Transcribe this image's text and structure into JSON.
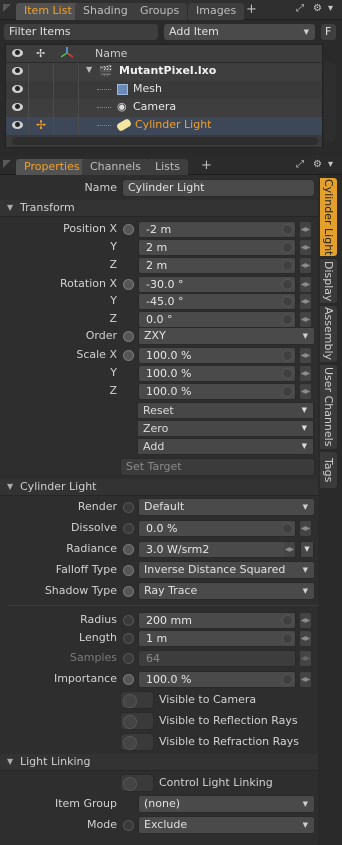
{
  "top_tabs": [
    "Item List",
    "Shading",
    "Groups",
    "Images"
  ],
  "filter_label": "Filter Items",
  "add_item_label": "Add Item",
  "f_button": "F",
  "list_header_name": "Name",
  "items": [
    {
      "label": "MutantPixel.lxo",
      "type": "scene"
    },
    {
      "label": "Mesh",
      "type": "mesh"
    },
    {
      "label": "Camera",
      "type": "camera"
    },
    {
      "label": "Cylinder Light",
      "type": "light",
      "selected": true
    }
  ],
  "props_tabs": [
    "Properties",
    "Channels",
    "Lists"
  ],
  "vertical_tabs": [
    "Cylinder Light",
    "Display",
    "Assembly",
    "User Channels",
    "Tags"
  ],
  "name_label": "Name",
  "name_value": "Cylinder Light",
  "transform": {
    "header": "Transform",
    "position_label": "Position X",
    "pos": [
      "-2 m",
      "2 m",
      "2 m"
    ],
    "rotation_label": "Rotation X",
    "rot": [
      "-30.0 °",
      "-45.0 °",
      "0.0 °"
    ],
    "order_label": "Order",
    "order_value": "ZXY",
    "scale_label": "Scale X",
    "scale": [
      "100.0 %",
      "100.0 %",
      "100.0 %"
    ],
    "axis_y": "Y",
    "axis_z": "Z",
    "reset": "Reset",
    "zero": "Zero",
    "add": "Add",
    "set_target": "Set Target"
  },
  "cylinder": {
    "header": "Cylinder Light",
    "render_label": "Render",
    "render_value": "Default",
    "dissolve_label": "Dissolve",
    "dissolve_value": "0.0 %",
    "radiance_label": "Radiance",
    "radiance_value": "3.0 W/srm2",
    "falloff_label": "Falloff Type",
    "falloff_value": "Inverse Distance Squared",
    "shadow_label": "Shadow Type",
    "shadow_value": "Ray Trace",
    "radius_label": "Radius",
    "radius_value": "200 mm",
    "length_label": "Length",
    "length_value": "1 m",
    "samples_label": "Samples",
    "samples_value": "64",
    "importance_label": "Importance",
    "importance_value": "100.0 %",
    "vis_camera": "Visible to Camera",
    "vis_reflection": "Visible to Reflection Rays",
    "vis_refraction": "Visible to Refraction Rays"
  },
  "linking": {
    "header": "Light Linking",
    "control": "Control Light Linking",
    "item_group_label": "Item Group",
    "item_group_value": "(none)",
    "mode_label": "Mode",
    "mode_value": "Exclude"
  },
  "colors": {
    "accent": "#f2a12a",
    "selected_row": "#3d4757"
  }
}
